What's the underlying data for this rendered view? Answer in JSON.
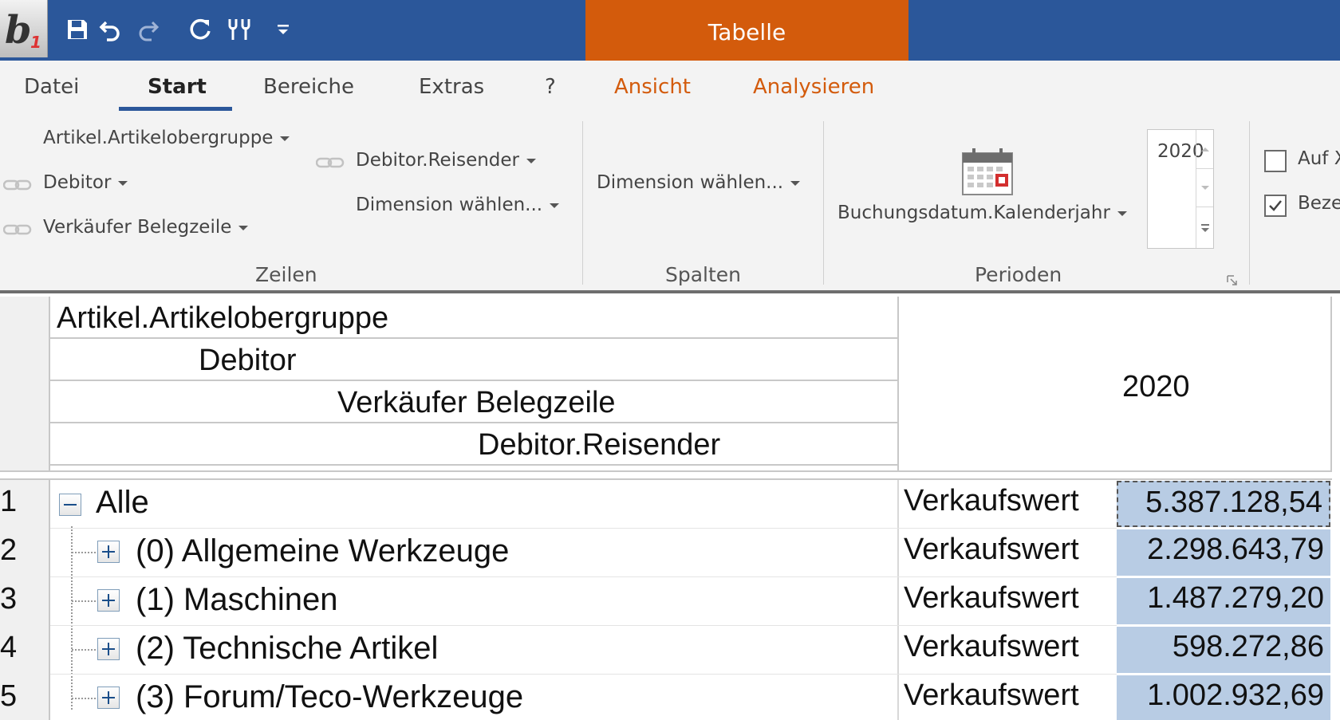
{
  "app": {
    "logo_text": "b1",
    "context_tab": "Tabelle"
  },
  "quick_access": [
    "save-icon",
    "undo-icon",
    "redo-icon",
    "refresh-icon",
    "tools-icon",
    "customize-icon"
  ],
  "tabs": [
    {
      "label": "Datei"
    },
    {
      "label": "Start",
      "active": true
    },
    {
      "label": "Bereiche"
    },
    {
      "label": "Extras"
    },
    {
      "label": "?"
    },
    {
      "label": "Ansicht",
      "contextual": true
    },
    {
      "label": "Analysieren",
      "contextual": true
    }
  ],
  "ribbon": {
    "zeilen": {
      "label": "Zeilen",
      "col1": [
        "Artikel.Artikelobergruppe",
        "Debitor",
        "Verkäufer Belegzeile"
      ],
      "col2": [
        "Debitor.Reisender",
        "Dimension wählen..."
      ]
    },
    "spalten": {
      "label": "Spalten",
      "dimension": "Dimension wählen..."
    },
    "perioden": {
      "label": "Perioden",
      "field": "Buchungsdatum.Kalenderjahr",
      "year": "2020"
    },
    "options": [
      {
        "label": "Auf X",
        "checked": false
      },
      {
        "label": "Beze",
        "checked": true
      }
    ]
  },
  "grid": {
    "row_headers": [
      "Artikel.Artikelobergruppe",
      "Debitor",
      "Verkäufer Belegzeile",
      "Debitor.Reisender"
    ],
    "column_header": "2020",
    "rows": [
      {
        "num": "1",
        "label": "Alle",
        "toggle": "collapse",
        "measure": "Verkaufswert",
        "value": "5.387.128,54",
        "selected": true
      },
      {
        "num": "2",
        "label": "(0) Allgemeine Werkzeuge",
        "toggle": "expand",
        "measure": "Verkaufswert",
        "value": "2.298.643,79"
      },
      {
        "num": "3",
        "label": "(1) Maschinen",
        "toggle": "expand",
        "measure": "Verkaufswert",
        "value": "1.487.279,20"
      },
      {
        "num": "4",
        "label": "(2) Technische Artikel",
        "toggle": "expand",
        "measure": "Verkaufswert",
        "value": "598.272,86"
      },
      {
        "num": "5",
        "label": "(3) Forum/Teco-Werkzeuge",
        "toggle": "expand",
        "measure": "Verkaufswert",
        "value": "1.002.932,69"
      }
    ]
  },
  "colors": {
    "titlebar": "#2b579a",
    "context_tab": "#d35b0c",
    "value_cell": "#b8cce4"
  }
}
